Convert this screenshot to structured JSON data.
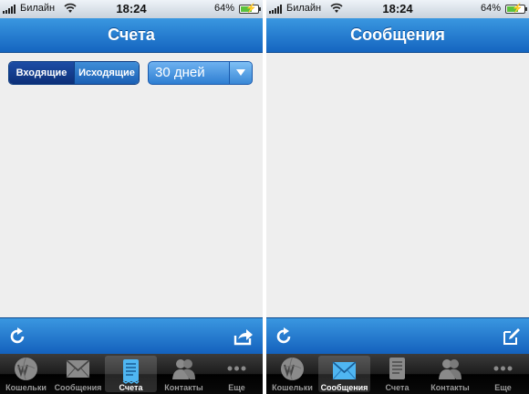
{
  "status_bar": {
    "carrier": "Билайн",
    "time": "18:24",
    "battery": "64%"
  },
  "left_screen": {
    "title": "Счета",
    "segments": [
      {
        "label": "Входящие"
      },
      {
        "label": "Исходящие"
      }
    ],
    "period_select": {
      "value": "30 дней"
    }
  },
  "right_screen": {
    "title": "Сообщения"
  },
  "tabs": [
    {
      "label": "Кошельки"
    },
    {
      "label": "Сообщения"
    },
    {
      "label": "Счета"
    },
    {
      "label": "Контакты"
    },
    {
      "label": "Еще"
    }
  ],
  "active_tab": {
    "left_screen": "Счета",
    "right_screen": "Сообщения"
  },
  "colors": {
    "nav_blue": "#1f7ad1",
    "active_tab_icon": "#4fb6f2",
    "tab_bar": "#1a1a1a"
  }
}
